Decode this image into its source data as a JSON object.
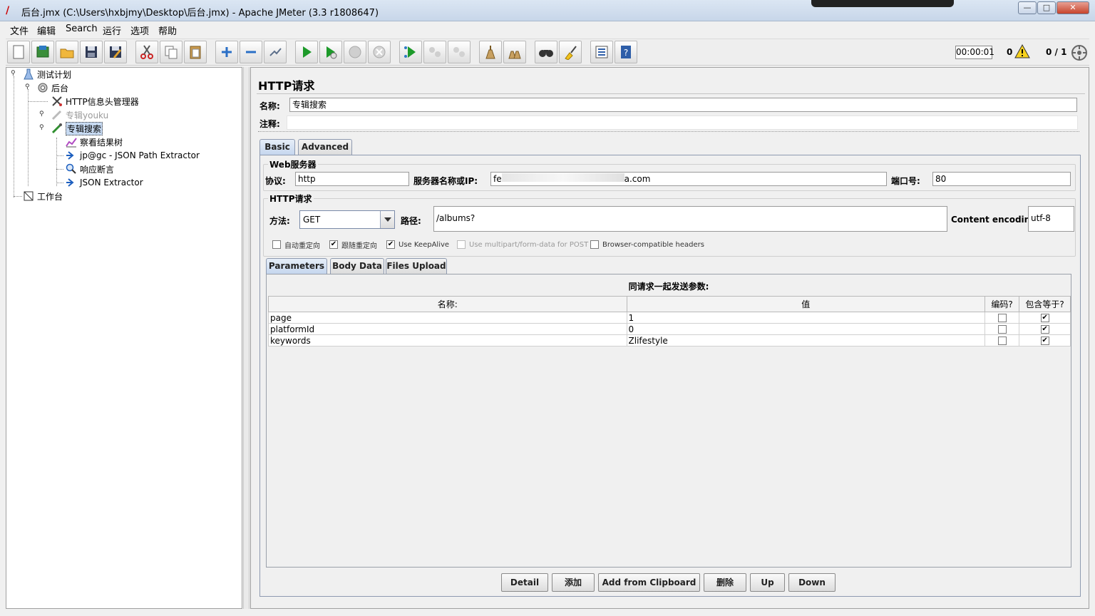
{
  "window": {
    "title": "后台.jmx (C:\\Users\\hxbjmy\\Desktop\\后台.jmx) - Apache JMeter (3.3 r1808647)",
    "min_label": "—",
    "max_label": "□",
    "close_label": "✕"
  },
  "menu": [
    "文件",
    "编辑",
    "Search",
    "运行",
    "选项",
    "帮助"
  ],
  "toolbar": {
    "icons": [
      "new-icon",
      "templates-icon",
      "open-icon",
      "save-icon",
      "save-as-icon",
      "cut-icon",
      "copy-icon",
      "paste-icon",
      "expand-icon",
      "collapse-icon",
      "toggle-icon",
      "start-icon",
      "start-no-timers-icon",
      "stop-icon",
      "shutdown-icon",
      "remote-start-icon",
      "remote-stop-icon",
      "remote-exit-icon",
      "clear-icon",
      "clear-all-icon",
      "search-icon",
      "reset-search-icon",
      "function-helper-icon",
      "help-icon"
    ],
    "timer": "00:00:01",
    "error_count": "0",
    "threads": "0 / 1"
  },
  "tree": {
    "nodes": [
      {
        "label": "测试计划",
        "icon": "test-plan-icon"
      },
      {
        "label": "后台",
        "icon": "thread-group-icon"
      },
      {
        "label": "HTTP信息头管理器",
        "icon": "header-manager-icon"
      },
      {
        "label": "专辑youku",
        "icon": "sampler-disabled-icon"
      },
      {
        "label": "专辑搜索",
        "icon": "sampler-icon"
      },
      {
        "label": "察看结果树",
        "icon": "results-tree-icon"
      },
      {
        "label": "jp@gc - JSON Path Extractor",
        "icon": "extractor-icon"
      },
      {
        "label": "响应断言",
        "icon": "assertion-icon"
      },
      {
        "label": "JSON Extractor",
        "icon": "extractor-icon"
      },
      {
        "label": "工作台",
        "icon": "workbench-icon"
      }
    ]
  },
  "sampler": {
    "title": "HTTP请求",
    "name_label": "名称:",
    "name_value": "专辑搜索",
    "comment_label": "注释:",
    "comment_value": "",
    "tabs": [
      "Basic",
      "Advanced"
    ],
    "web_server_title": "Web服务器",
    "protocol_label": "协议:",
    "protocol_value": "http",
    "server_label": "服务器名称或IP:",
    "server_prefix": "fe",
    "server_suffix": "a.com",
    "port_label": "端口号:",
    "port_value": "80",
    "http_group_title": "HTTP请求",
    "method_label": "方法:",
    "method_value": "GET",
    "path_label": "路径:",
    "path_value": "/albums?",
    "encoding_label": "Content encoding:",
    "encoding_value": "utf-8",
    "options": [
      {
        "label": "自动重定向",
        "checked": false,
        "disabled": false
      },
      {
        "label": "跟随重定向",
        "checked": true,
        "disabled": false
      },
      {
        "label": "Use KeepAlive",
        "checked": true,
        "disabled": false
      },
      {
        "label": "Use multipart/form-data for POST",
        "checked": false,
        "disabled": true
      },
      {
        "label": "Browser-compatible headers",
        "checked": false,
        "disabled": false
      }
    ],
    "param_tabs": [
      "Parameters",
      "Body Data",
      "Files Upload"
    ],
    "params_heading": "同请求一起发送参数:",
    "columns": [
      "名称:",
      "值",
      "编码?",
      "包含等于?"
    ],
    "params": [
      {
        "name": "page",
        "value": "1",
        "encode": false,
        "include_equals": true
      },
      {
        "name": "platformId",
        "value": "0",
        "encode": false,
        "include_equals": true
      },
      {
        "name": "keywords",
        "value": "Zlifestyle",
        "encode": false,
        "include_equals": true
      }
    ],
    "buttons": [
      "Detail",
      "添加",
      "Add from Clipboard",
      "删除",
      "Up",
      "Down"
    ]
  }
}
